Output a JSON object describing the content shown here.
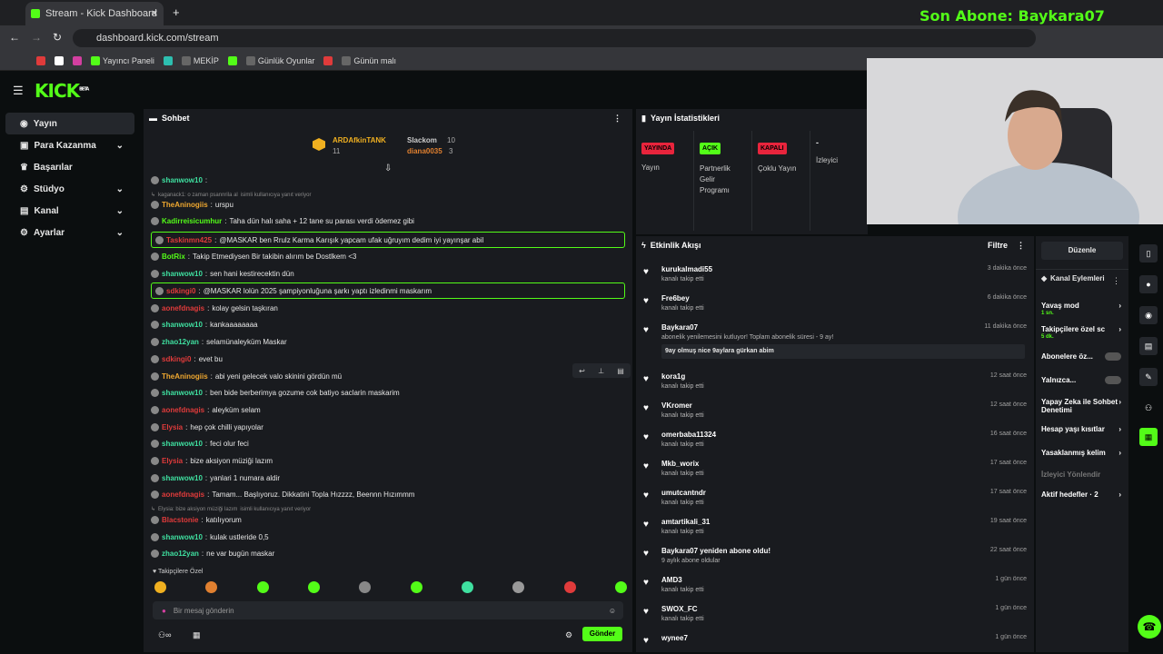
{
  "browser": {
    "tab_title": "Stream - Kick Dashboard",
    "url": "dashboard.kick.com/stream",
    "overlay_text": "Son Abone: Baykara07",
    "bookmarks": [
      "Yayıncı Paneli",
      "MEKİP",
      "Günlük Oyunlar",
      "Günün malı"
    ]
  },
  "app": {
    "logo": "KICK",
    "logo_badge": "BETA"
  },
  "sidebar": {
    "items": [
      {
        "label": "Yayın"
      },
      {
        "label": "Para Kazanma"
      },
      {
        "label": "Başarılar"
      },
      {
        "label": "Stüdyo"
      },
      {
        "label": "Kanal"
      },
      {
        "label": "Ayarlar"
      }
    ]
  },
  "chat": {
    "title": "Sohbet",
    "input_placeholder": "Bir mesaj gönderin",
    "send_label": "Gönder",
    "followers_only": "Takipçilere Özel",
    "top_gifters": {
      "first": "ARDAfkinTANK",
      "first_count": "11",
      "second": "Slackom",
      "second_count": "10",
      "third": "diana0035",
      "third_count": "3"
    },
    "messages": [
      {
        "user": "shanwow10",
        "text": "",
        "color": "#3fe0a0"
      },
      {
        "reply": "kaganack1: o zaman psannrila al",
        "reply_tail": "isimli kullanıcıya yanıt veriyor"
      },
      {
        "user": "TheAninogiis",
        "text": "urspu",
        "color": "#f0a830"
      },
      {
        "user": "Kadirreisicumhur",
        "text": "Taha dün halı saha + 12 tane su parası verdi ödemez gibi",
        "color": "#53fc18"
      },
      {
        "user": "Taskinmn425",
        "text": "@MASKAR ben Rrulz Karma Karışık yapcam ufak uğruyım dedim iyi yayınşar abil",
        "color": "#e03b3b",
        "highlight": true
      },
      {
        "user": "BotRix",
        "text": "Takip Etmediysen Bir takibin alırım be Dostlkem <3",
        "color": "#53fc18"
      },
      {
        "user": "shanwow10",
        "text": "sen hani kestirecektin dün",
        "color": "#3fe0a0"
      },
      {
        "user": "sdkingi0",
        "text": "@MASKAR lolün 2025 şampiyonluğuna şarkı yaptı izledinmi maskarım",
        "color": "#e03b3b",
        "highlight": true
      },
      {
        "user": "aonefdnagis",
        "text": "kolay gelsin taşkıran",
        "color": "#e03b3b"
      },
      {
        "user": "shanwow10",
        "text": "kankaaaaaaaa",
        "color": "#3fe0a0"
      },
      {
        "user": "zhao12yan",
        "text": "selamünaleyküm Maskar",
        "color": "#3fe0a0"
      },
      {
        "user": "sdkingi0",
        "text": "evet bu",
        "color": "#e03b3b"
      },
      {
        "user": "TheAninogiis",
        "text": "abi yeni gelecek valo skinini gördün mü",
        "color": "#f0a830"
      },
      {
        "user": "shanwow10",
        "text": "ben bide berberimya gozume cok batiyo saclarin maskarim",
        "color": "#3fe0a0"
      },
      {
        "user": "aonefdnagis",
        "text": "aleyküm selam",
        "color": "#e03b3b"
      },
      {
        "user": "Elysia",
        "text": "hep çok chilli yapıyolar",
        "color": "#e03b3b"
      },
      {
        "user": "shanwow10",
        "text": "feci olur feci",
        "color": "#3fe0a0"
      },
      {
        "user": "Elysia",
        "text": "bize aksiyon müziği lazım",
        "color": "#e03b3b"
      },
      {
        "user": "shanwow10",
        "text": "yanlari 1 numara aldir",
        "color": "#3fe0a0"
      },
      {
        "user": "aonefdnagis",
        "text": "Tamam... Başlıyoruz. Dikkatini Topla Hızzzz, Beennn Hızımmm",
        "color": "#e03b3b"
      },
      {
        "reply": "Elysia: bize aksiyon müziği lazım",
        "reply_tail": "isimli kullanıcıya yanıt veriyor"
      },
      {
        "user": "Blacstonie",
        "text": "katılıyorum",
        "color": "#e03b3b"
      },
      {
        "user": "shanwow10",
        "text": "kulak ustleride 0,5",
        "color": "#3fe0a0"
      },
      {
        "user": "zhao12yan",
        "text": "ne var bugün maskar",
        "color": "#3fe0a0"
      }
    ]
  },
  "stats": {
    "title": "Yayın İstatistikleri",
    "items": [
      {
        "badge": "YAYINDA",
        "label": "Yayın",
        "color": "#e8243c"
      },
      {
        "badge": "AÇIK",
        "label": "Partnerlik Gelir Programı",
        "color": "#53fc18"
      },
      {
        "badge": "KAPALI",
        "label": "Çoklu Yayın",
        "color": "#e8243c"
      },
      {
        "badge": "-",
        "label": "İzleyici",
        "color": ""
      }
    ]
  },
  "activity": {
    "title": "Etkinlik Akışı",
    "filter": "Filtre",
    "items": [
      {
        "name": "kurukalmadi55",
        "sub": "kanalı takip etti",
        "time": "3 dakika önce"
      },
      {
        "name": "Fre6bey",
        "sub": "kanalı takip etti",
        "time": "6 dakika önce"
      },
      {
        "name": "Baykara07",
        "sub": "abonelik yenilemesini kutluyor! Toplam abonelik süresi - 9 ay!",
        "time": "11 dakika önce",
        "note": "9ay olmuş nice 9aylara gürkan abim"
      },
      {
        "name": "kora1g",
        "sub": "kanalı takip etti",
        "time": "12 saat önce"
      },
      {
        "name": "VKromer",
        "sub": "kanalı takip etti",
        "time": "12 saat önce"
      },
      {
        "name": "omerbaba11324",
        "sub": "kanalı takip etti",
        "time": "16 saat önce"
      },
      {
        "name": "Mkb_worix",
        "sub": "kanalı takip etti",
        "time": "17 saat önce"
      },
      {
        "name": "umutcantndr",
        "sub": "kanalı takip etti",
        "time": "17 saat önce"
      },
      {
        "name": "amtartikali_31",
        "sub": "kanalı takip etti",
        "time": "19 saat önce"
      },
      {
        "name": "Baykara07 yeniden abone oldu!",
        "sub": "9 aylık abone oldular",
        "time": "22 saat önce"
      },
      {
        "name": "AMD3",
        "sub": "kanalı takip etti",
        "time": "1 gün önce"
      },
      {
        "name": "SWOX_FC",
        "sub": "kanalı takip etti",
        "time": "1 gün önce"
      },
      {
        "name": "wynee7",
        "sub": "",
        "time": "1 gün önce"
      }
    ]
  },
  "channel_actions": {
    "edit": "Düzenle",
    "title": "Kanal Eylemleri",
    "items": [
      {
        "label": "Yavaş mod",
        "sub": "1 sn."
      },
      {
        "label": "Takipçilere özel sc",
        "sub": "5 dk."
      },
      {
        "label": "Abonelere öz..."
      },
      {
        "label": "Yalnızca..."
      },
      {
        "label": "Yapay Zeka ile Sohbet Denetimi"
      },
      {
        "label": "Hesap yaşı kısıtlar"
      },
      {
        "label": "Yasaklanmış kelim"
      },
      {
        "label": "İzleyici Yönlendir"
      },
      {
        "label": "Aktif hedefler · 2"
      }
    ]
  }
}
